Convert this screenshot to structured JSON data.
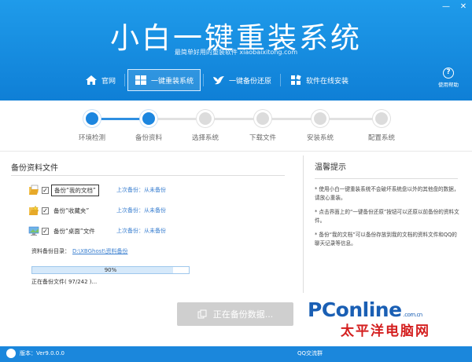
{
  "header": {
    "title": "小白一键重装系统",
    "subtitle": "最简单好用的重装软件 xiaobaixitong.com",
    "window_controls": [
      "—",
      "✕"
    ]
  },
  "nav": {
    "items": [
      {
        "label": "官网",
        "icon": "home-icon",
        "active": false
      },
      {
        "label": "一键重装系统",
        "icon": "windows-icon",
        "active": true
      },
      {
        "label": "一键备份还原",
        "icon": "bird-icon",
        "active": false
      },
      {
        "label": "软件在线安装",
        "icon": "grid-icon",
        "active": false
      }
    ],
    "help_label": "使用帮助",
    "help_icon": "question-icon"
  },
  "steps": {
    "items": [
      {
        "label": "环境检测",
        "done": true
      },
      {
        "label": "备份资料",
        "done": true
      },
      {
        "label": "选择系统",
        "done": false
      },
      {
        "label": "下载文件",
        "done": false
      },
      {
        "label": "安装系统",
        "done": false
      },
      {
        "label": "配置系统",
        "done": false
      }
    ]
  },
  "backup": {
    "title": "备份资料文件",
    "rows": [
      {
        "label": "备份“我的文档”",
        "status": "上次备份：从未备份",
        "checked": true,
        "icon": "documents-folder-icon"
      },
      {
        "label": "备份“收藏夹”",
        "status": "上次备份：从未备份",
        "checked": true,
        "icon": "favorites-folder-icon"
      },
      {
        "label": "备份“桌面”文件",
        "status": "上次备份：从未备份",
        "checked": true,
        "icon": "desktop-icon"
      }
    ],
    "dir_label": "资料备份目录：",
    "dir_path": "D:\\XBGhost\\资料备份",
    "progress_percent": 90,
    "progress_text": "90%",
    "progress_status": "正在备份文件( 97/242 )..."
  },
  "tips": {
    "title": "温馨提示",
    "items": [
      "* 使用小白一键重装系统不会破坏系统盘以外的其他盘的数据，请放心重装。",
      "* 点击界面上的“一键备份还原”按钮可以还原以前备份的资料文件。",
      "* 备份“我的文档”可以备份存放到我的文档的资料文件和QQ的聊天记录等信息。"
    ]
  },
  "action": {
    "label": "正在备份数据...",
    "icon": "copy-icon"
  },
  "footer": {
    "version": "版本：Ver9.0.0.0",
    "right_text": "QQ交流群"
  },
  "watermark": {
    "brand": "PConline",
    "domain": ".com.cn",
    "chinese": "太平洋电脑网"
  },
  "colors": {
    "header_blue": "#1f9bea",
    "step_done": "#1c86df",
    "link": "#3a7fd0",
    "footer": "#1b87dc"
  }
}
